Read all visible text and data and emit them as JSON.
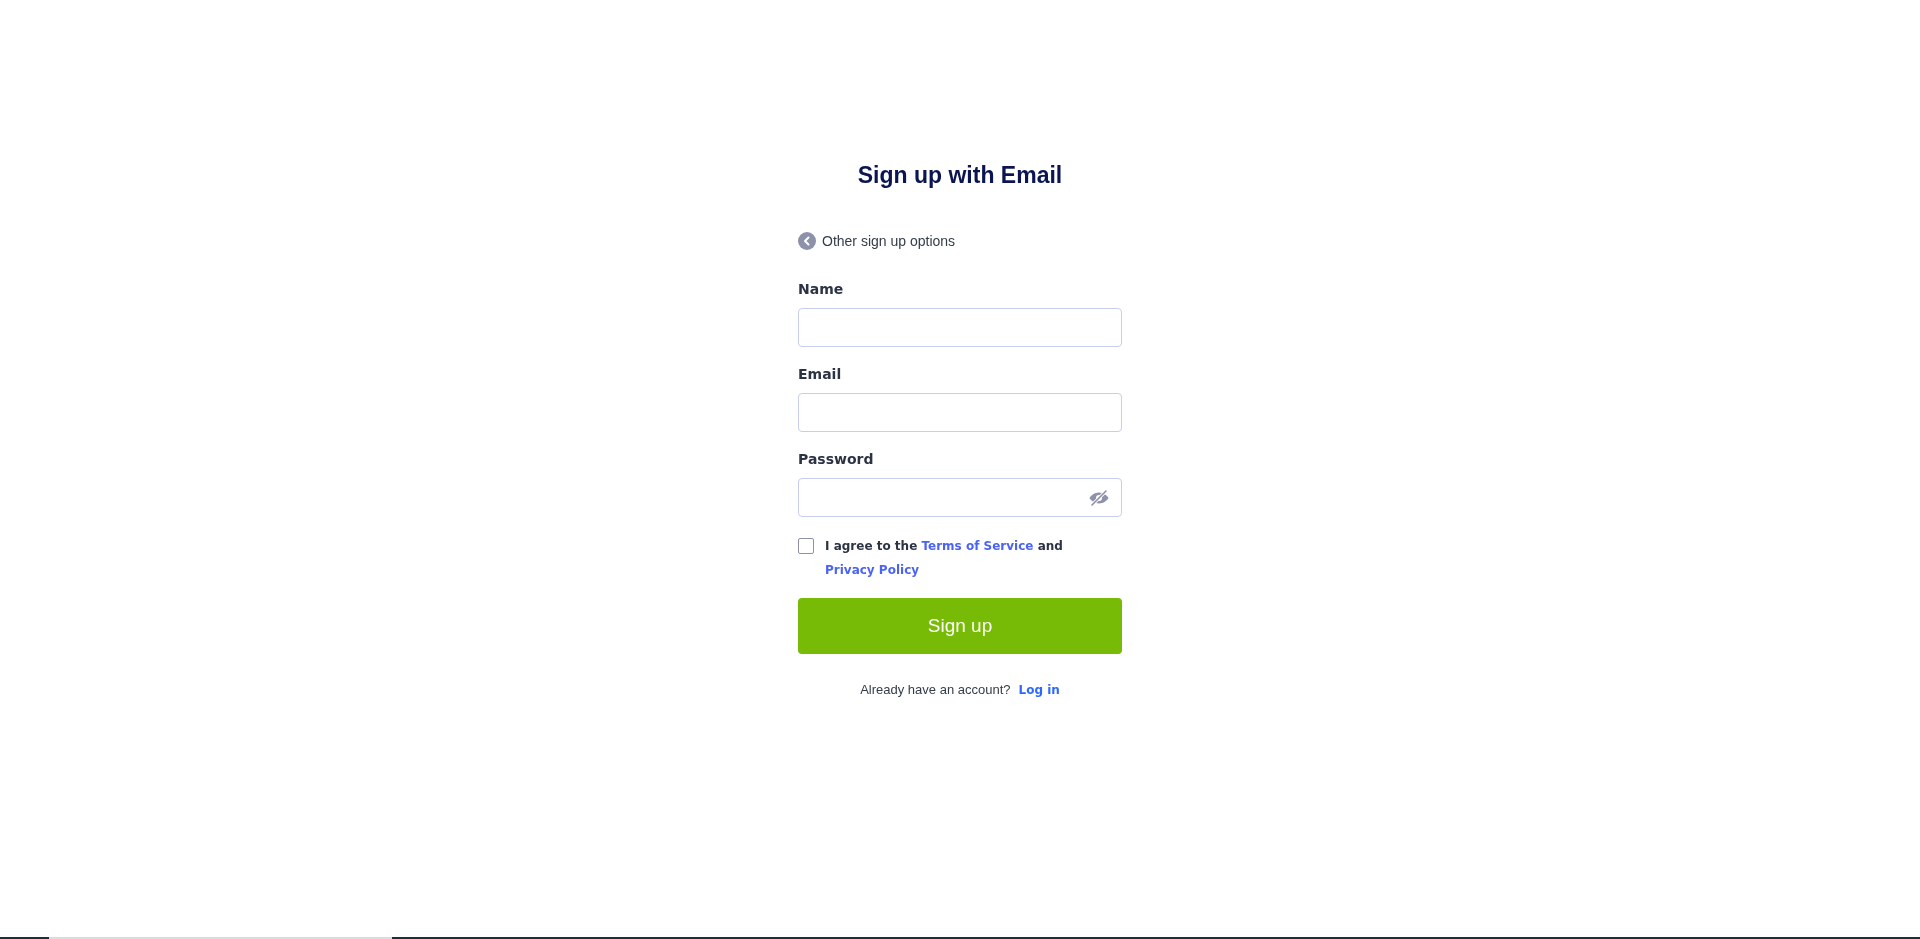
{
  "heading": "Sign up with Email",
  "back_link": {
    "label": "Other sign up options"
  },
  "fields": [
    {
      "label": "Name",
      "reveal_toggle": false
    },
    {
      "label": "Email",
      "reveal_toggle": false
    },
    {
      "label": "Password",
      "reveal_toggle": true
    }
  ],
  "agreement": {
    "checked": false,
    "segments": [
      {
        "kind": "text",
        "text": "I agree to the"
      },
      {
        "kind": "link",
        "text": "Terms of Service"
      },
      {
        "kind": "text",
        "text": "and"
      },
      {
        "kind": "link",
        "text": "Privacy Policy"
      }
    ]
  },
  "submit": {
    "label": "Sign up"
  },
  "login": {
    "prompt": "Already have an account?",
    "link": "Log in"
  }
}
